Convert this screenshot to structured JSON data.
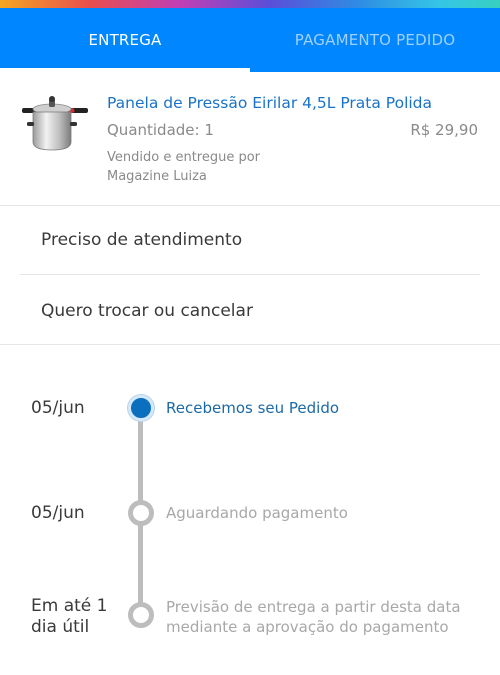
{
  "tabs": [
    {
      "label": "ENTREGA",
      "active": true
    },
    {
      "label": "PAGAMENTO PEDIDO",
      "active": false
    }
  ],
  "product": {
    "name": "Panela de Pressão Eirilar 4,5L Prata Polida",
    "quantity": "Quantidade: 1",
    "price": "R$ 29,90",
    "seller_line1": "Vendido e entregue por",
    "seller_line2": "Magazine Luiza",
    "image_icon": "pressure-cooker"
  },
  "menu": [
    {
      "label": "Preciso de atendimento"
    },
    {
      "label": "Quero trocar ou cancelar"
    }
  ],
  "timeline": [
    {
      "date": "05/jun",
      "label": "Recebemos seu Pedido",
      "status": "done"
    },
    {
      "date": "05/jun",
      "label": "Aguardando pagamento",
      "status": "pending"
    },
    {
      "date_line1": "Em até 1",
      "date_line2": "dia útil",
      "label_line1": "Previsão de entrega a partir desta data",
      "label_line2": "mediante a aprovação do pagamento",
      "status": "pending"
    }
  ],
  "colors": {
    "header_blue": "#0086ff",
    "link_blue": "#1a73c8",
    "active_dot": "#0a6fbf",
    "muted": "#8a8a8a"
  }
}
